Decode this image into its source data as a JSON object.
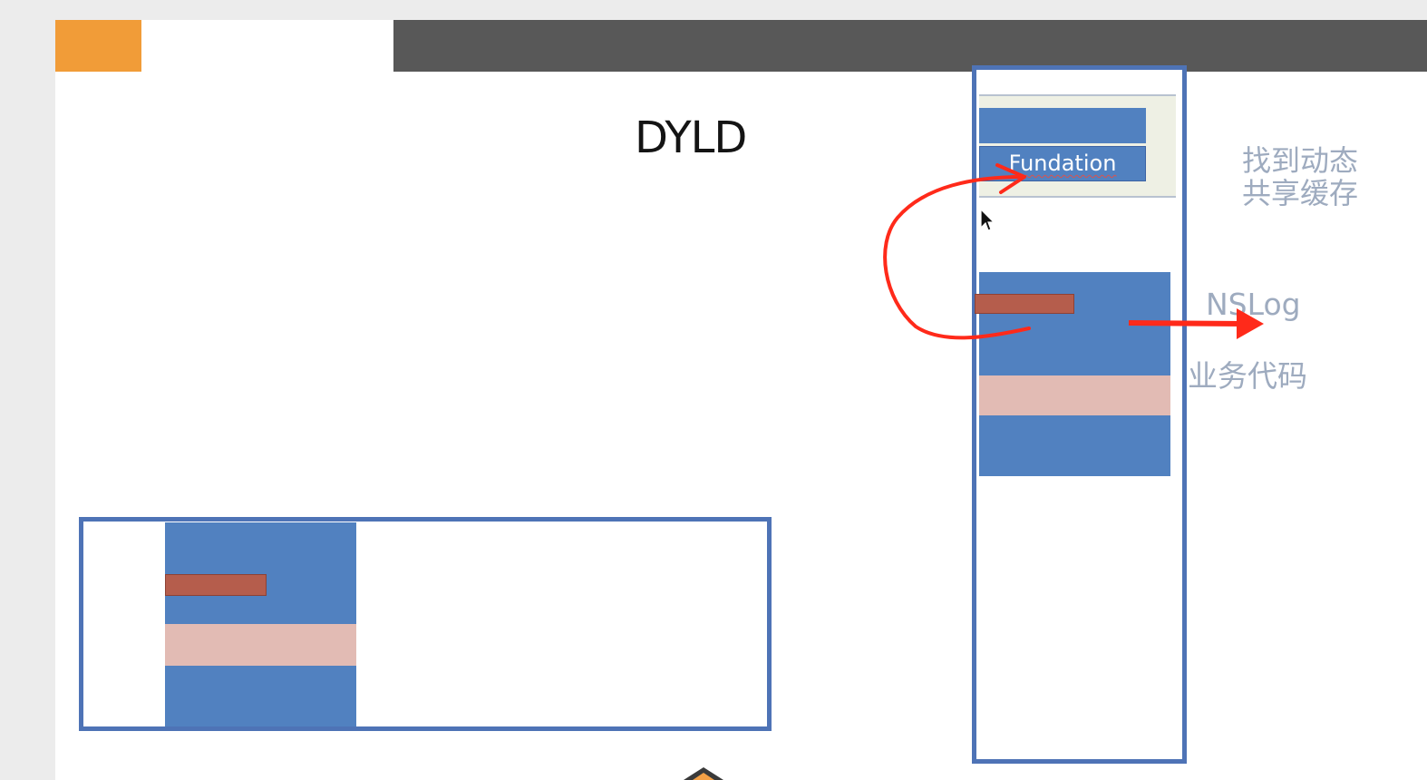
{
  "slide": {
    "title": "DYLD",
    "colors": {
      "accent_orange": "#f19c38",
      "header_dark": "#585858",
      "memory_border": "#4e73b6",
      "block_blue": "#5181c0",
      "stub_red": "#b55d4c",
      "band_pink": "#e2bbb4",
      "arrow_red": "#ff2a1a",
      "label_grey_blue": "#9eabbf"
    }
  },
  "diagram": {
    "shared_cache": {
      "library_label": "Fundation"
    },
    "labels": {
      "find_shared_cache_line1": "找到动态",
      "find_shared_cache_line2": "共享缓存",
      "nslog": "NSLog",
      "business_code": "业务代码"
    },
    "icons": {
      "cursor": "mouse-pointer-icon",
      "arrow_curved": "curved-arrow-icon",
      "arrow_straight": "right-arrow-icon"
    }
  }
}
